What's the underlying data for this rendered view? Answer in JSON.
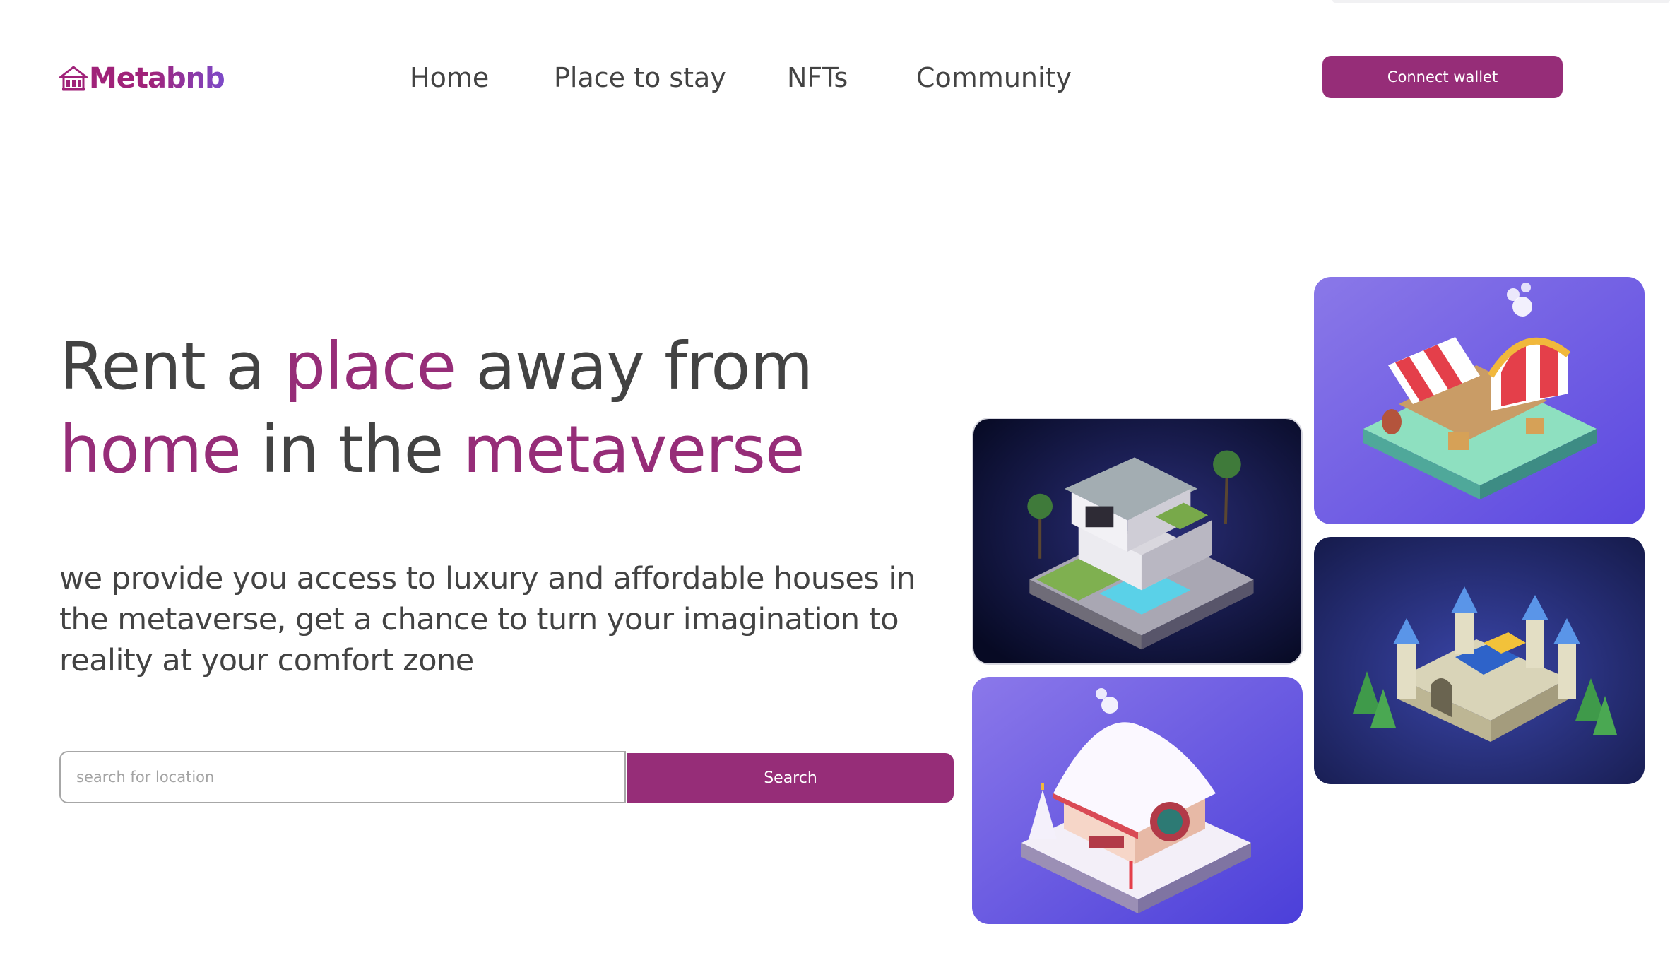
{
  "brand": {
    "logo_text": "Metabnb",
    "logo_icon": "house-icon"
  },
  "nav": {
    "items": [
      {
        "label": "Home"
      },
      {
        "label": "Place to stay"
      },
      {
        "label": "NFTs"
      },
      {
        "label": "Community"
      }
    ],
    "cta_label": "Connect wallet"
  },
  "hero": {
    "title_part1": "Rent a ",
    "title_accent1": "place",
    "title_part2": " away from",
    "title_accent2": "home",
    "title_part3": " in the ",
    "title_accent3": "metaverse",
    "subtitle": "we provide you access to luxury and affordable houses in the metaverse, get a chance to turn your imagination to reality at your comfort zone",
    "search": {
      "placeholder": "search for location",
      "value": "",
      "button_label": "Search"
    }
  },
  "gallery": {
    "tiles": [
      {
        "name": "modern-villa-image"
      },
      {
        "name": "market-stall-image"
      },
      {
        "name": "castle-image"
      },
      {
        "name": "winter-cottage-image"
      }
    ]
  },
  "colors": {
    "accent": "#962d78",
    "text": "#434343",
    "logo_gradient_end": "#7c4ac9"
  }
}
